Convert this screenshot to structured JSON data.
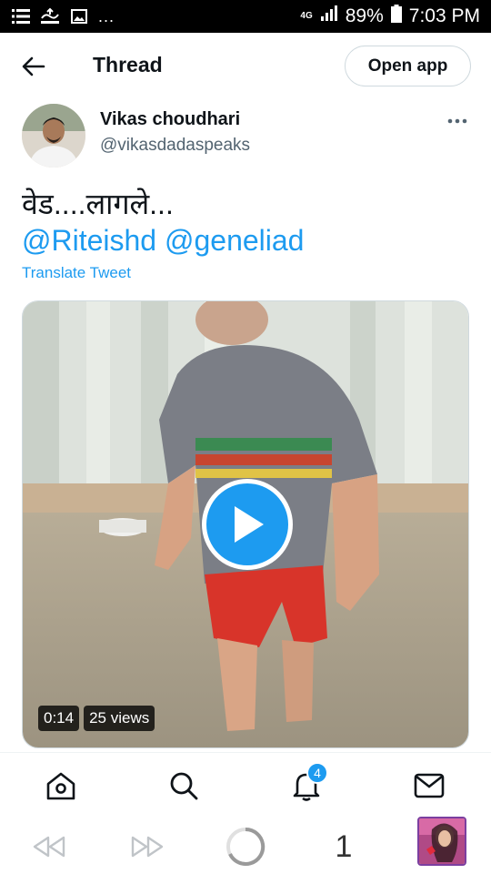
{
  "status_bar": {
    "network": "4G",
    "battery": "89%",
    "time": "7:03 PM",
    "left_icons": [
      "list-icon",
      "cast-icon",
      "image-icon"
    ],
    "overflow": "..."
  },
  "header": {
    "title": "Thread",
    "open_app_label": "Open app"
  },
  "author": {
    "name": "Vikas choudhari",
    "handle": "@vikasdadaspeaks"
  },
  "tweet": {
    "text": "वेड....लागले...",
    "mentions": "@Riteishd @geneliad",
    "translate_label": "Translate Tweet"
  },
  "video": {
    "duration": "0:14",
    "views": "25 views"
  },
  "bottom_nav": {
    "items": [
      "home-icon",
      "search-icon",
      "notifications-icon",
      "messages-icon"
    ],
    "notification_count": "4"
  },
  "browser_bar": {
    "tab_count": "1"
  },
  "colors": {
    "accent": "#1d9bf0",
    "text": "#0f1419",
    "secondary": "#536471"
  }
}
